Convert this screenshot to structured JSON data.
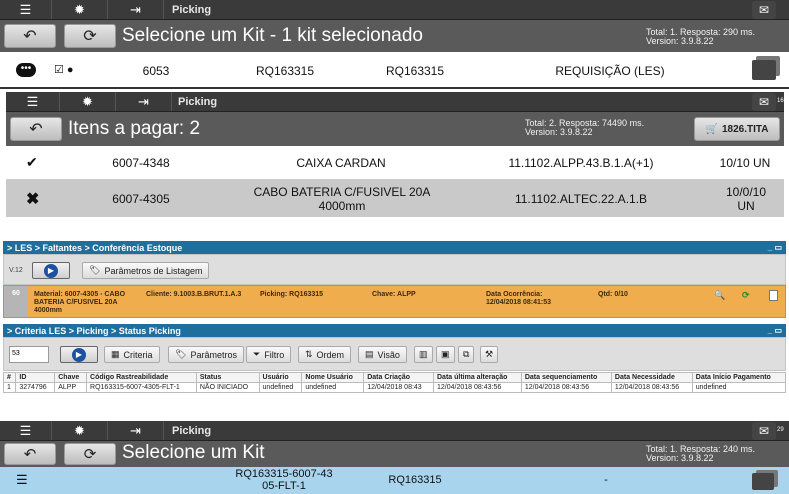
{
  "panel1": {
    "title": "Picking",
    "heading": "Selecione um Kit - 1 kit selecionado",
    "meta_total": "Total: 1. Resposta: 290 ms.",
    "meta_version": "Version: 3.9.8.22",
    "row": {
      "c1": "6053",
      "c2": "RQ163315",
      "c3": "RQ163315",
      "c4": "REQUISIÇÃO (LES)"
    }
  },
  "panel2": {
    "title": "Picking",
    "mail_badge": "16",
    "heading": "Itens a pagar: 2",
    "meta_total": "Total: 2. Resposta: 74490 ms.",
    "meta_version": "Version: 3.9.8.22",
    "cart_label": "1826.TITA",
    "rows": [
      {
        "code": "6007-4348",
        "desc": "CAIXA CARDAN",
        "loc": "11.1102.ALPP.43.B.1.A(+1)",
        "qty": "10/10 UN"
      },
      {
        "code": "6007-4305",
        "desc1": "CABO BATERIA C/FUSIVEL 20A",
        "desc2": "4000mm",
        "loc": "11.1102.ALTEC.22.A.1.B",
        "qty1": "10/0/10",
        "qty2": "UN"
      }
    ]
  },
  "panel3": {
    "breadcrumb": "> LES > Faltantes > Conferência Estoque",
    "version_label": "V.12",
    "params_button": "Parâmetros de Listagem",
    "alert": {
      "num": "60",
      "material1": "Material: 6007-4305 - CABO",
      "material2": "BATERIA C/FUSIVEL 20A",
      "material3": "4000mm",
      "cliente": "Cliente: 9.1003.B.BRUT.1.A.3",
      "picking": "Picking: RQ163315",
      "chave": "Chave: ALPP",
      "data1": "Data Ocorrência:",
      "data2": "12/04/2018 08:41:53",
      "qtd": "Qtd: 0/10"
    },
    "breadcrumb2": "> Criteria LES > Picking > Status Picking",
    "page_size": "53",
    "toolbar": [
      "Criteria",
      "Parâmetros",
      "Filtro",
      "Ordem",
      "Visão"
    ],
    "columns": [
      "#",
      "ID",
      "Chave",
      "Código Rastreabilidade",
      "Status",
      "Usuário",
      "Nome Usuário",
      "Data Criação",
      "Data última alteração",
      "Data sequenciamento",
      "Data Necessidade",
      "Data Início Pagamento"
    ],
    "rows": [
      [
        "1",
        "3274796",
        "ALPP",
        "RQ163315-6007-4305-FLT-1",
        "NÃO INICIADO",
        "undefined",
        "undefined",
        "12/04/2018 08:43",
        "12/04/2018 08:43:56",
        "12/04/2018 08:43:56",
        "12/04/2018 08:43:56",
        "undefined"
      ]
    ]
  },
  "panel4": {
    "title": "Picking",
    "mail_badge": "29",
    "heading": "Selecione um Kit",
    "meta_total": "Total: 1. Resposta: 240 ms.",
    "meta_version": "Version: 3.9.8.22",
    "row": {
      "c1a": "RQ163315-6007-43",
      "c1b": "05-FLT-1",
      "c2": "RQ163315",
      "c3": "-"
    }
  }
}
